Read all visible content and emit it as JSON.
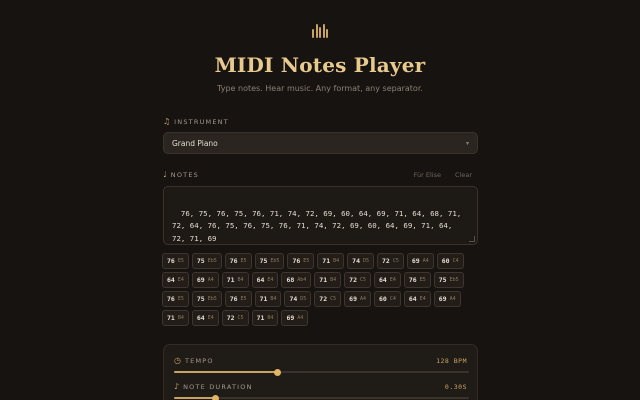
{
  "header": {
    "title": "MIDI Notes Player",
    "subtitle": "Type notes. Hear music. Any format, any separator.",
    "logo_icon": "piano-bars-icon"
  },
  "instrument": {
    "label": "INSTRUMENT",
    "selected": "Grand Piano"
  },
  "notes": {
    "label": "NOTES",
    "preset_label": "Für Elise",
    "clear_label": "Clear",
    "text": "76, 75, 76, 75, 76, 71, 74, 72, 69, 60, 64, 69, 71, 64, 68, 71,\n72, 64, 76, 75, 76, 75, 76, 71, 74, 72, 69, 60, 64, 69, 71, 64,\n72, 71, 69"
  },
  "chips": [
    {
      "num": "76",
      "name": "E5"
    },
    {
      "num": "75",
      "name": "Eb5"
    },
    {
      "num": "76",
      "name": "E5"
    },
    {
      "num": "75",
      "name": "Eb5"
    },
    {
      "num": "76",
      "name": "E5"
    },
    {
      "num": "71",
      "name": "B4"
    },
    {
      "num": "74",
      "name": "D5"
    },
    {
      "num": "72",
      "name": "C5"
    },
    {
      "num": "69",
      "name": "A4"
    },
    {
      "num": "60",
      "name": "C4"
    },
    {
      "num": "64",
      "name": "E4"
    },
    {
      "num": "69",
      "name": "A4"
    },
    {
      "num": "71",
      "name": "B4"
    },
    {
      "num": "64",
      "name": "E4"
    },
    {
      "num": "68",
      "name": "Ab4"
    },
    {
      "num": "71",
      "name": "B4"
    },
    {
      "num": "72",
      "name": "C5"
    },
    {
      "num": "64",
      "name": "E4"
    },
    {
      "num": "76",
      "name": "E5"
    },
    {
      "num": "75",
      "name": "Eb5"
    },
    {
      "num": "76",
      "name": "E5"
    },
    {
      "num": "75",
      "name": "Eb5"
    },
    {
      "num": "76",
      "name": "E5"
    },
    {
      "num": "71",
      "name": "B4"
    },
    {
      "num": "74",
      "name": "D5"
    },
    {
      "num": "72",
      "name": "C5"
    },
    {
      "num": "69",
      "name": "A4"
    },
    {
      "num": "60",
      "name": "C4"
    },
    {
      "num": "64",
      "name": "E4"
    },
    {
      "num": "69",
      "name": "A4"
    },
    {
      "num": "71",
      "name": "B4"
    },
    {
      "num": "64",
      "name": "E4"
    },
    {
      "num": "72",
      "name": "C5"
    },
    {
      "num": "71",
      "name": "B4"
    },
    {
      "num": "69",
      "name": "A4"
    }
  ],
  "controls": {
    "tempo": {
      "label": "TEMPO",
      "value": "128 BPM",
      "fraction": 0.35
    },
    "duration": {
      "label": "NOTE DURATION",
      "value": "0.30S",
      "fraction": 0.14
    }
  },
  "colors": {
    "accent": "#c9a364",
    "background": "#171310"
  }
}
